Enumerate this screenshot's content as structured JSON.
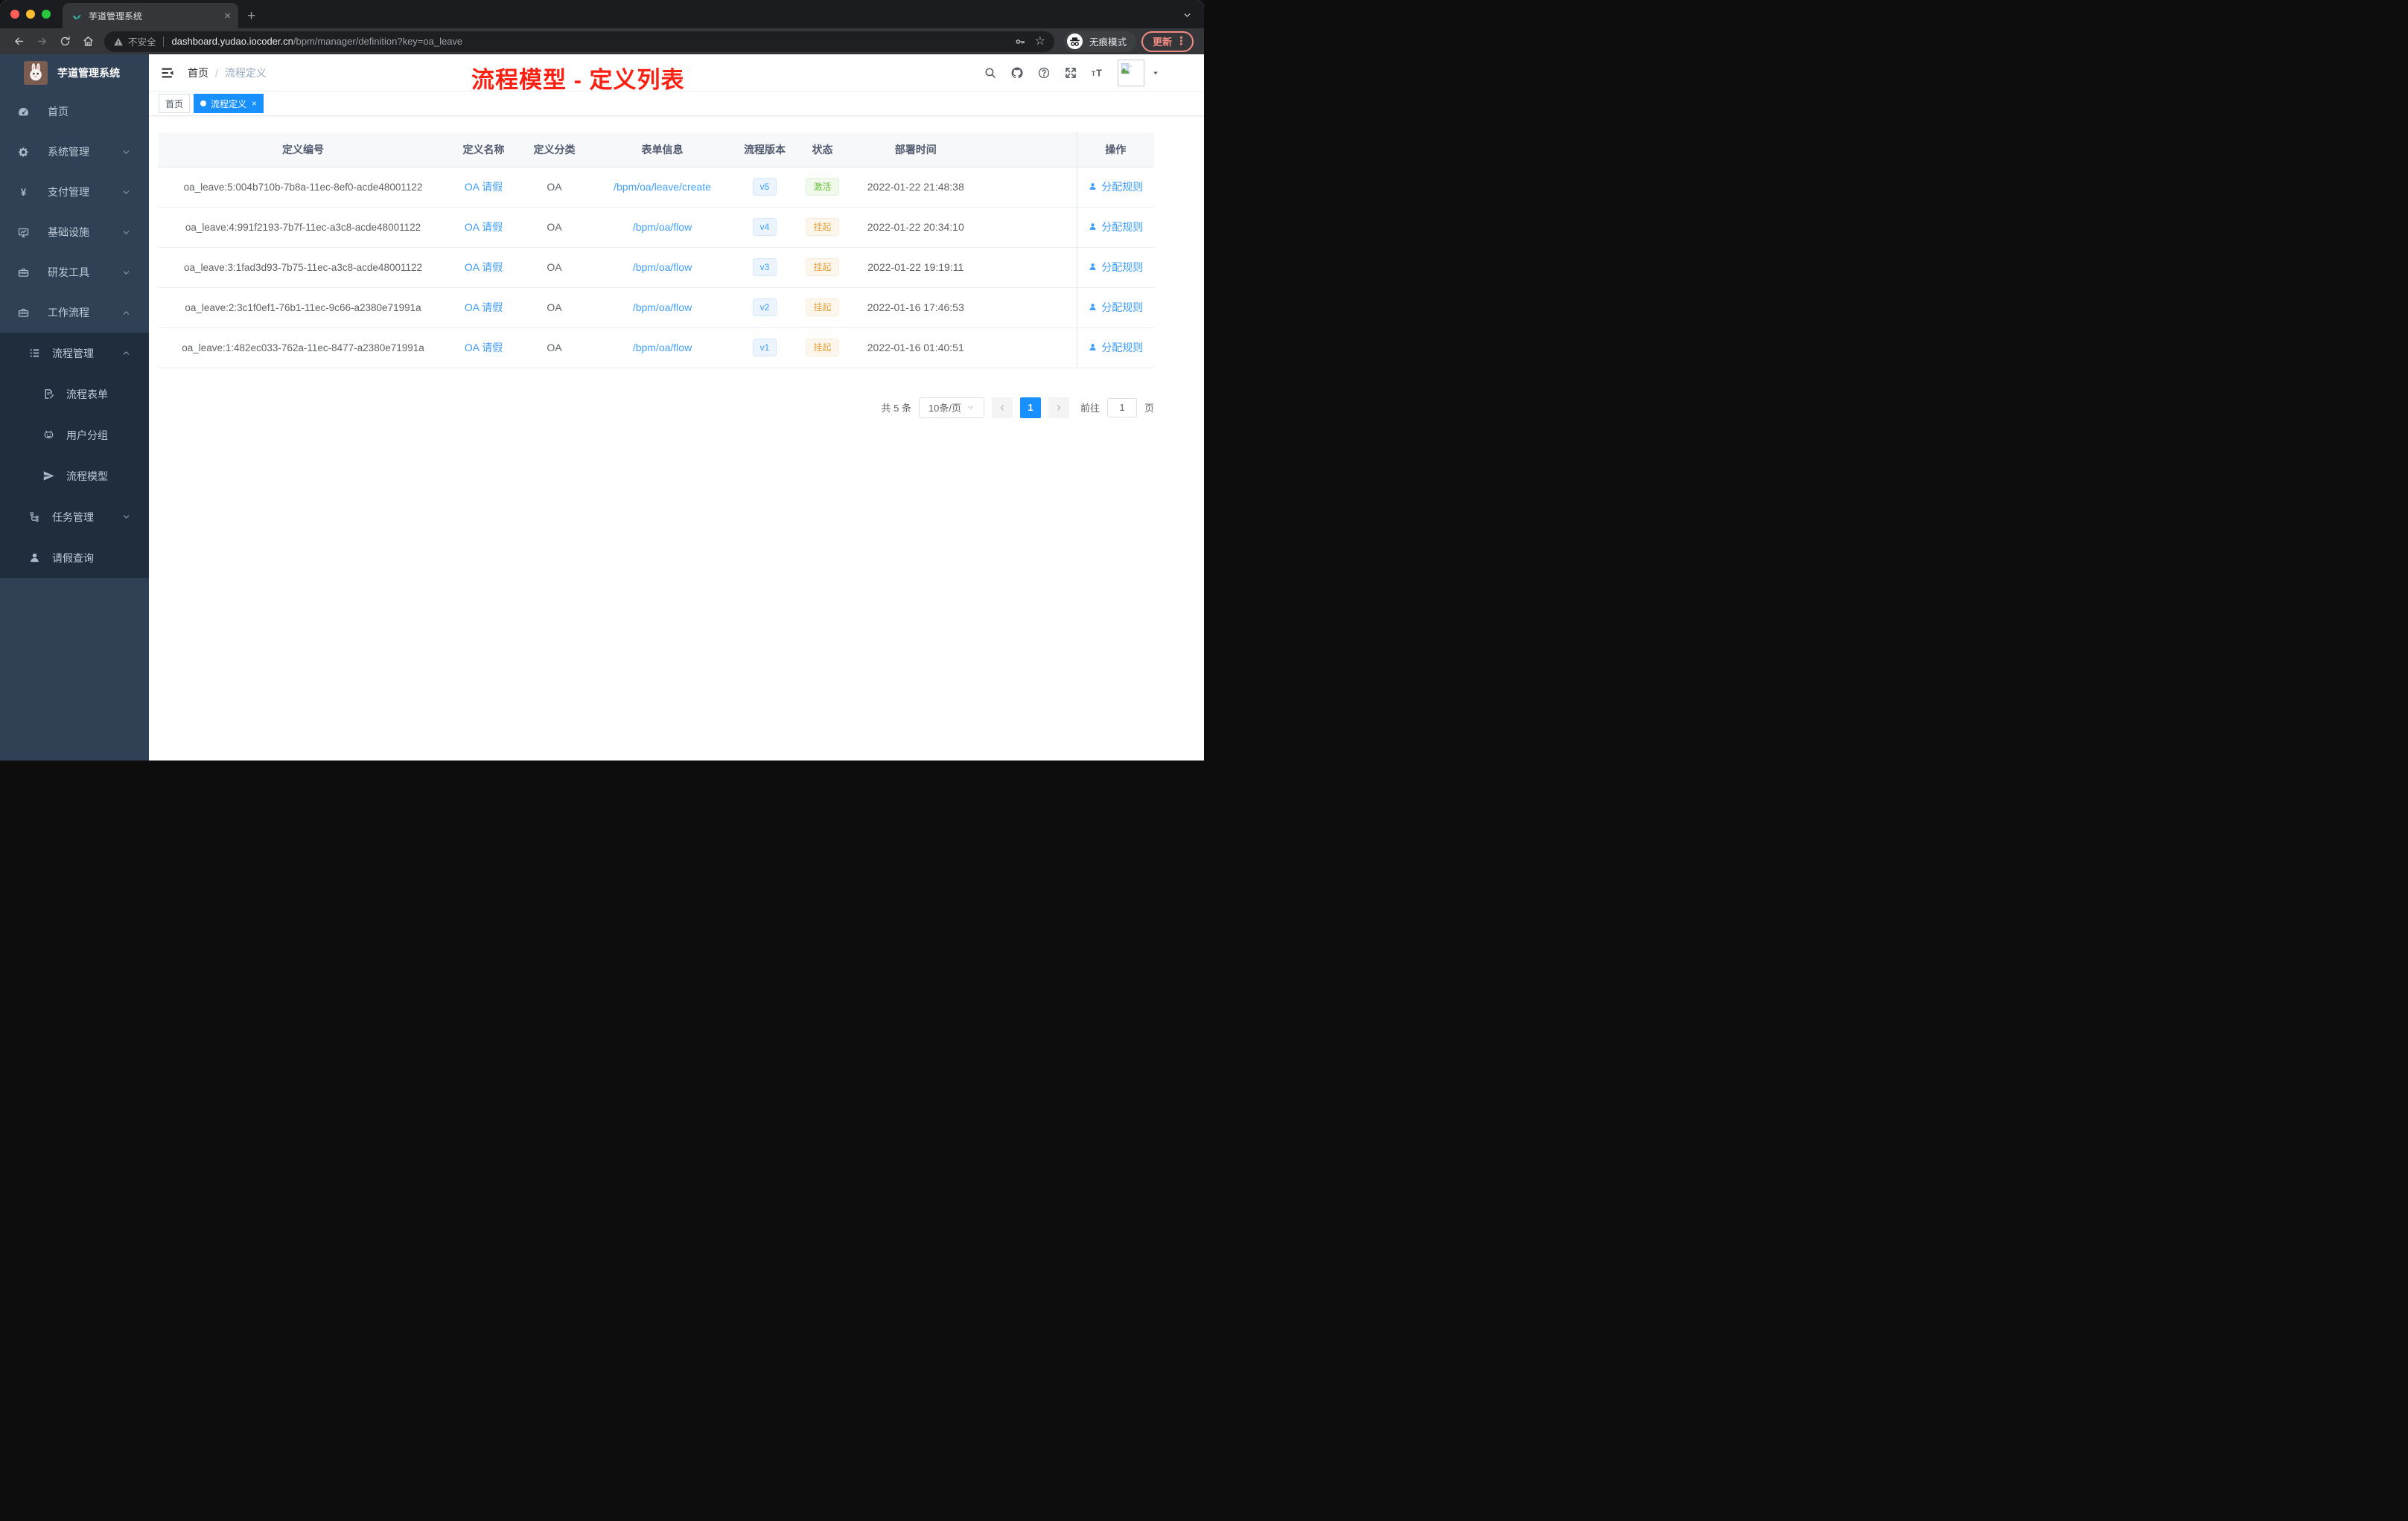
{
  "browser": {
    "tab": {
      "title": "芋道管理系统"
    },
    "address": {
      "security": "不安全",
      "host": "dashboard.yudao.iocoder.cn",
      "path": "/bpm/manager/definition?key=oa_leave"
    },
    "incognito": "无痕模式",
    "update": "更新"
  },
  "sidebar": {
    "title": "芋道管理系统",
    "menu": [
      {
        "label": "首页",
        "icon": "dashboard-icon",
        "cls": "d1",
        "chevron": ""
      },
      {
        "label": "系统管理",
        "icon": "gear-icon",
        "cls": "d1",
        "chevron": "down"
      },
      {
        "label": "支付管理",
        "icon": "yen-icon",
        "cls": "d1",
        "chevron": "down"
      },
      {
        "label": "基础设施",
        "icon": "monitor-icon",
        "cls": "d1",
        "chevron": "down"
      },
      {
        "label": "研发工具",
        "icon": "toolbox-icon",
        "cls": "d1",
        "chevron": "down"
      },
      {
        "label": "工作流程",
        "icon": "briefcase-icon",
        "cls": "d1",
        "chevron": "up"
      },
      {
        "label": "流程管理",
        "icon": "process-list-icon",
        "cls": "d2 dark",
        "chevron": "up"
      },
      {
        "label": "流程表单",
        "icon": "form-edit-icon",
        "cls": "d3 dark",
        "chevron": ""
      },
      {
        "label": "用户分组",
        "icon": "robot-icon",
        "cls": "d3 dark",
        "chevron": ""
      },
      {
        "label": "流程模型",
        "icon": "paper-plane-icon",
        "cls": "d3 dark",
        "chevron": ""
      },
      {
        "label": "任务管理",
        "icon": "org-tree-icon",
        "cls": "d2 dark",
        "chevron": "down"
      },
      {
        "label": "请假查询",
        "icon": "user-icon",
        "cls": "d2 dark",
        "chevron": ""
      }
    ]
  },
  "navbar": {
    "breadcrumb": {
      "home": "首页",
      "separator": "/",
      "current": "流程定义"
    },
    "annotation": "流程模型 - 定义列表",
    "annotation_color": "#fa2012"
  },
  "tags": [
    {
      "label": "首页",
      "state": ""
    },
    {
      "label": "流程定义",
      "state": "active"
    }
  ],
  "table": {
    "headers": [
      "定义编号",
      "定义名称",
      "定义分类",
      "表单信息",
      "流程版本",
      "状态",
      "部署时间",
      "操作"
    ],
    "rows": [
      {
        "id": "oa_leave:5:004b710b-7b8a-11ec-8ef0-acde48001122",
        "name": "OA 请假",
        "category": "OA",
        "form": "/bpm/oa/leave/create",
        "version": "v5",
        "status": "激活",
        "status_type": "success",
        "deployed_at": "2022-01-22 21:48:38",
        "action": "分配规则"
      },
      {
        "id": "oa_leave:4:991f2193-7b7f-11ec-a3c8-acde48001122",
        "name": "OA 请假",
        "category": "OA",
        "form": "/bpm/oa/flow",
        "version": "v4",
        "status": "挂起",
        "status_type": "warning",
        "deployed_at": "2022-01-22 20:34:10",
        "action": "分配规则"
      },
      {
        "id": "oa_leave:3:1fad3d93-7b75-11ec-a3c8-acde48001122",
        "name": "OA 请假",
        "category": "OA",
        "form": "/bpm/oa/flow",
        "version": "v3",
        "status": "挂起",
        "status_type": "warning",
        "deployed_at": "2022-01-22 19:19:11",
        "action": "分配规则"
      },
      {
        "id": "oa_leave:2:3c1f0ef1-76b1-11ec-9c66-a2380e71991a",
        "name": "OA 请假",
        "category": "OA",
        "form": "/bpm/oa/flow",
        "version": "v2",
        "status": "挂起",
        "status_type": "warning",
        "deployed_at": "2022-01-16 17:46:53",
        "action": "分配规则"
      },
      {
        "id": "oa_leave:1:482ec033-762a-11ec-8477-a2380e71991a",
        "name": "OA 请假",
        "category": "OA",
        "form": "/bpm/oa/flow",
        "version": "v1",
        "status": "挂起",
        "status_type": "warning",
        "deployed_at": "2022-01-16 01:40:51",
        "action": "分配规则"
      }
    ]
  },
  "pagination": {
    "total": "共 5 条",
    "page_size": "10条/页",
    "page": "1",
    "goto": "前往",
    "unit": "页"
  }
}
